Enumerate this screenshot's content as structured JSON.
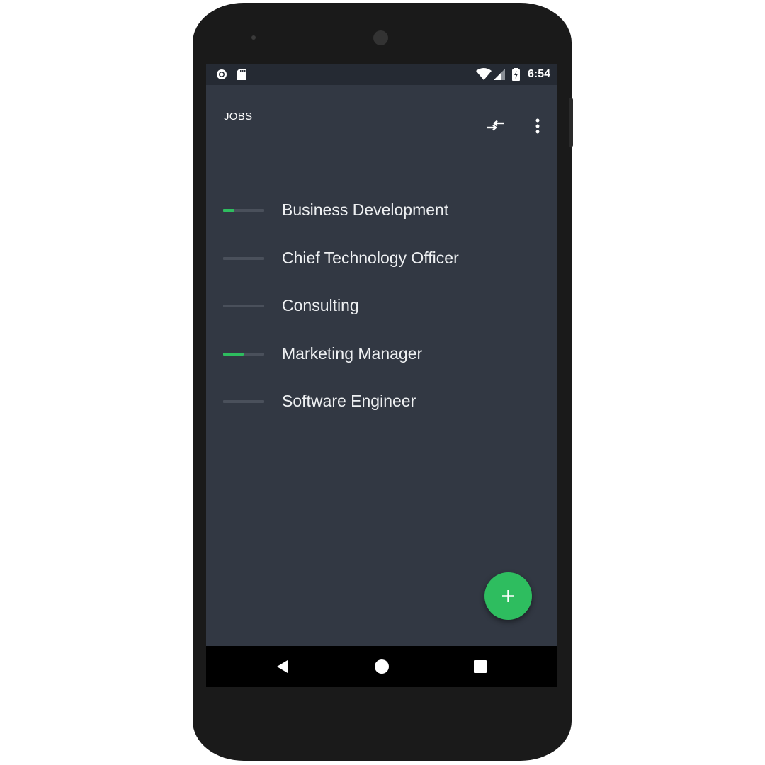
{
  "status_bar": {
    "time": "6:54",
    "left_icons": [
      "record-icon",
      "sd-card-icon"
    ],
    "right_icons": [
      "wifi-icon",
      "cell-signal-icon",
      "battery-charging-icon"
    ]
  },
  "toolbar": {
    "title": "JOBS",
    "actions": [
      "compare-arrows-icon",
      "more-vert-icon"
    ]
  },
  "jobs": [
    {
      "label": "Business Development",
      "progress": 0.27
    },
    {
      "label": "Chief Technology Officer",
      "progress": 0
    },
    {
      "label": "Consulting",
      "progress": 0
    },
    {
      "label": "Marketing Manager",
      "progress": 0.5
    },
    {
      "label": "Software Engineer",
      "progress": 0
    }
  ],
  "fab": {
    "icon": "plus-icon"
  },
  "nav": {
    "buttons": [
      "back-icon",
      "home-icon",
      "recents-icon"
    ]
  },
  "colors": {
    "accent": "#2ebd5f",
    "background": "#323843",
    "track": "#4a505b",
    "status_bar": "#252a33"
  }
}
